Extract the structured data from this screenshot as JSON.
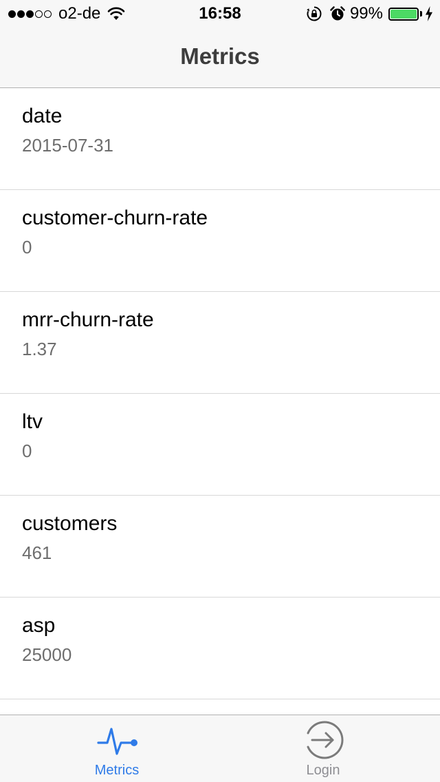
{
  "status_bar": {
    "signal_bars_on": 3,
    "signal_bars_total": 5,
    "carrier": "o2-de",
    "time": "16:58",
    "battery_percent": "99%",
    "battery_level": 0.99,
    "battery_color": "#4cd964",
    "icons": [
      "wifi-icon",
      "rotation-lock-icon",
      "alarm-icon",
      "battery-icon",
      "charging-bolt-icon"
    ]
  },
  "nav": {
    "title": "Metrics"
  },
  "metrics": [
    {
      "name": "date",
      "value": "2015-07-31"
    },
    {
      "name": "customer-churn-rate",
      "value": "0"
    },
    {
      "name": "mrr-churn-rate",
      "value": "1.37"
    },
    {
      "name": "ltv",
      "value": "0"
    },
    {
      "name": "customers",
      "value": "461"
    },
    {
      "name": "asp",
      "value": "25000"
    }
  ],
  "tab_bar": {
    "tabs": [
      {
        "label": "Metrics",
        "icon": "pulse-icon",
        "selected": true
      },
      {
        "label": "Login",
        "icon": "login-arrow-icon",
        "selected": false
      }
    ],
    "active_color": "#2f7be8",
    "inactive_color": "#8e8e93"
  }
}
